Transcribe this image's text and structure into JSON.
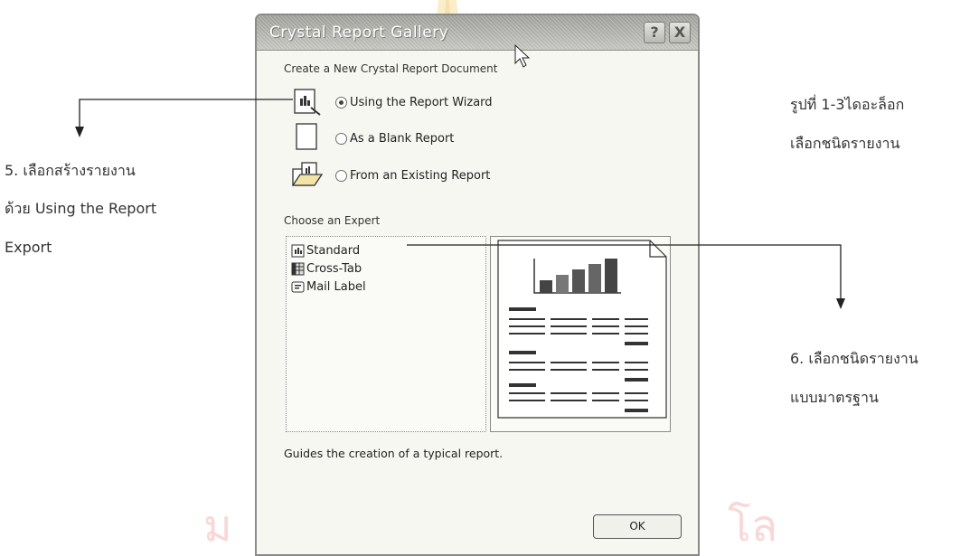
{
  "dialog": {
    "title": "Crystal Report Gallery",
    "help_button": "?",
    "close_button": "X",
    "section_create_label": "Create a New Crystal Report Document",
    "options": [
      {
        "label": "Using the Report Wizard",
        "selected": true,
        "icon": "wizard-icon"
      },
      {
        "label": "As a Blank Report",
        "selected": false,
        "icon": "blank-page-icon"
      },
      {
        "label": "From an Existing Report",
        "selected": false,
        "icon": "open-folder-icon"
      }
    ],
    "section_expert_label": "Choose an Expert",
    "experts": [
      {
        "label": "Standard",
        "icon": "standard-report-icon"
      },
      {
        "label": "Cross-Tab",
        "icon": "cross-tab-icon"
      },
      {
        "label": "Mail Label",
        "icon": "mail-label-icon"
      }
    ],
    "description": "Guides the creation of a typical report.",
    "ok_button": "OK"
  },
  "annotations": {
    "left_lines": [
      "5. เลือกสร้างรายงาน",
      "ด้วย Using the Report",
      "Export"
    ],
    "top_right_lines": [
      "รูปที่ 1-3ไดอะล็อก",
      "เลือกชนิดรายงาน"
    ],
    "bottom_right_lines": [
      "6. เลือกชนิดรายงาน",
      "แบบมาตรฐาน"
    ]
  },
  "colors": {
    "watermark_red": "#e84a48",
    "watermark_gold": "#f3cf74",
    "watermark_gray": "#a9a9a9"
  }
}
